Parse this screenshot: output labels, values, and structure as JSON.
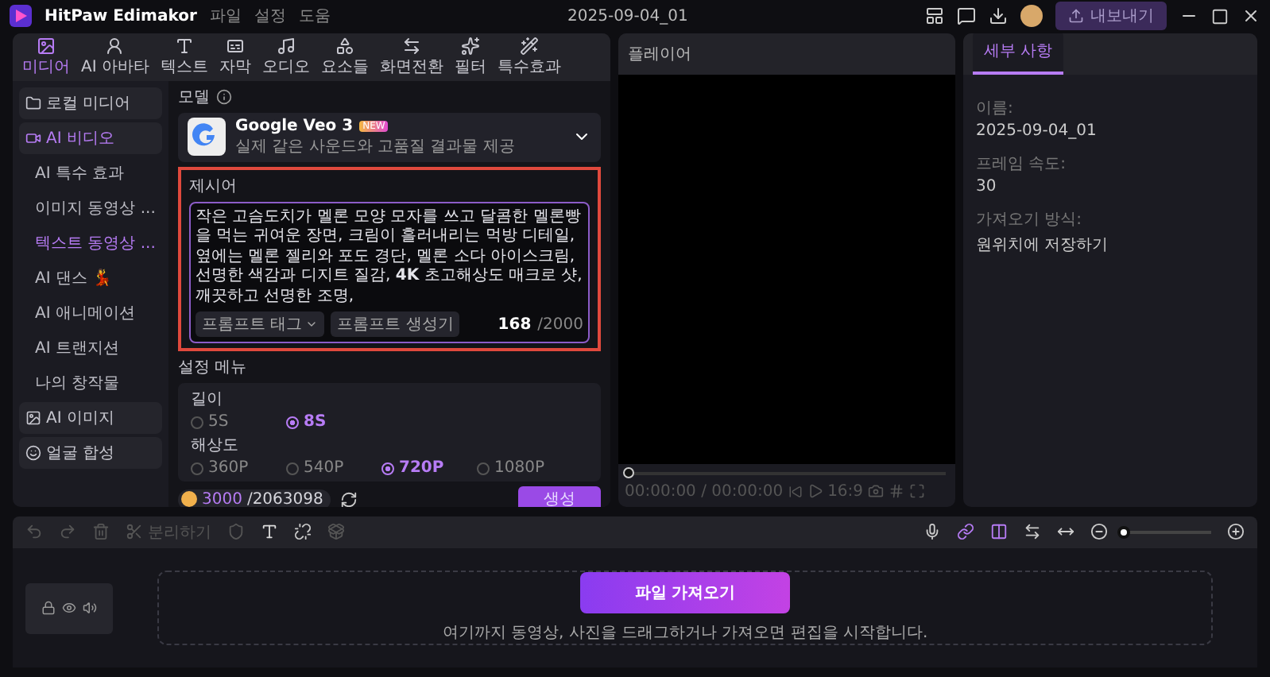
{
  "titlebar": {
    "app_name": "HitPaw Edimakor",
    "menu": [
      "파일",
      "설정",
      "도움"
    ],
    "project": "2025-09-04_01",
    "export": "내보내기"
  },
  "media_tabs": [
    {
      "label": "미디어",
      "selected": true
    },
    {
      "label": "AI 아바타",
      "selected": false
    },
    {
      "label": "텍스트",
      "selected": false
    },
    {
      "label": "자막",
      "selected": false
    },
    {
      "label": "오디오",
      "selected": false
    },
    {
      "label": "요소들",
      "selected": false
    },
    {
      "label": "화면전환",
      "selected": false
    },
    {
      "label": "필터",
      "selected": false
    },
    {
      "label": "특수효과",
      "selected": false
    }
  ],
  "sidebar": {
    "items": [
      {
        "label": "로컬 미디어",
        "selected": false
      },
      {
        "label": "AI 비디오",
        "selected": true,
        "children": [
          {
            "label": "AI 특수 효과",
            "selected": false
          },
          {
            "label": "이미지 동영상 ...",
            "selected": false
          },
          {
            "label": "텍스트 동영상 ...",
            "selected": true
          },
          {
            "label": "AI 댄스 💃",
            "selected": false
          },
          {
            "label": "AI 애니메이션",
            "selected": false
          },
          {
            "label": "AI 트랜지션",
            "selected": false
          },
          {
            "label": "나의 창작물",
            "selected": false
          }
        ]
      },
      {
        "label": "AI 이미지",
        "selected": false
      },
      {
        "label": "얼굴 합성",
        "selected": false
      }
    ]
  },
  "model": {
    "label": "모델",
    "name": "Google Veo 3",
    "badge": "NEW",
    "description": "실제 같은 사운드와 고품질 결과물 제공"
  },
  "prompt": {
    "label": "제시어",
    "value": "작은 고슴도치가 멜론 모양 모자를 쓰고 달콤한 멜론빵을 먹는 귀여운 장면, 크림이 흘러내리는 먹방 디테일, 옆에는 멜론 젤리와 포도 경단, 멜론 소다 아이스크림, 선명한 색감과 디지트 질감, **4K** 초고해상도 매크로 샷, 깨끗하고 선명한 조명,",
    "tags": [
      "프롬프트 태그",
      "프롬프트 생성기"
    ],
    "count": "168",
    "limit": "/2000"
  },
  "settings": {
    "label": "설정 메뉴",
    "groups": [
      {
        "label": "길이",
        "options": [
          {
            "label": "5S",
            "selected": false
          },
          {
            "label": "8S",
            "selected": true
          }
        ]
      },
      {
        "label": "해상도",
        "options": [
          {
            "label": "360P",
            "selected": false
          },
          {
            "label": "540P",
            "selected": false
          },
          {
            "label": "720P",
            "selected": true
          },
          {
            "label": "1080P",
            "selected": false
          }
        ]
      }
    ]
  },
  "credits": {
    "used": "3000",
    "total": "/2063098"
  },
  "generate": "생성",
  "player": {
    "title": "플레이어",
    "level": 0,
    "time": "00:00:00 / 00:00:00",
    "ratio": "16:9"
  },
  "details": {
    "tab": "세부 사항",
    "fields": [
      {
        "label": "이름:",
        "value": "2025-09-04_01"
      },
      {
        "label": "프레임 속도:",
        "value": "30"
      },
      {
        "label": "가져오기 방식:",
        "value": "원위치에 저장하기"
      }
    ]
  },
  "timeline": {
    "split": "분리하기",
    "zoom": {
      "level": 0
    },
    "import_button": "파일 가져오기",
    "hint": "여기까지 동영상, 사진을 드래그하거나 가져오면 편집을 시작합니다."
  }
}
